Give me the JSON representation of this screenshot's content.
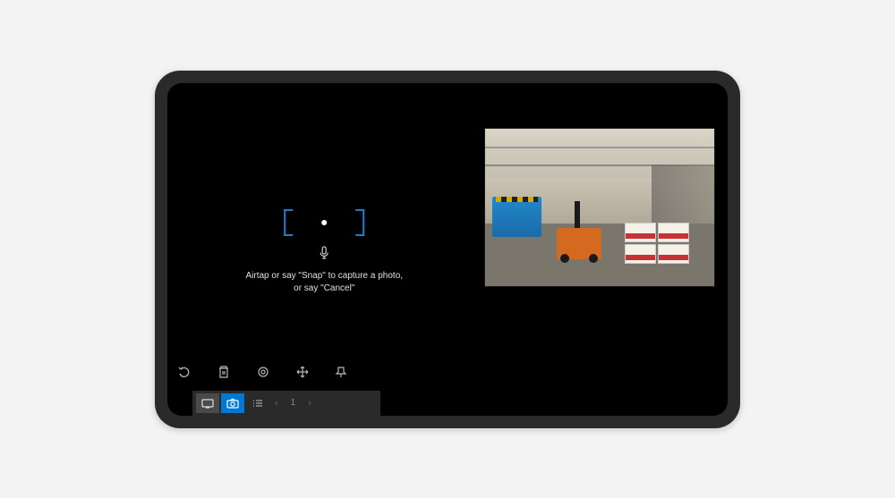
{
  "capture": {
    "instruction": "Airtap or say \"Snap\" to capture a photo,\nor say \"Cancel\""
  },
  "toolbar": {
    "undo": "undo",
    "delete": "delete",
    "properties": "properties",
    "move": "move",
    "pin": "pin"
  },
  "bottombar": {
    "tab1": "slide-tab",
    "tab2": "camera-tab",
    "tab3": "list-tab",
    "page": "1",
    "prev": "‹",
    "next": "›"
  },
  "colors": {
    "accent": "#0078d4",
    "reticle": "#1e7fcc",
    "forklift": "#d46a1f"
  }
}
